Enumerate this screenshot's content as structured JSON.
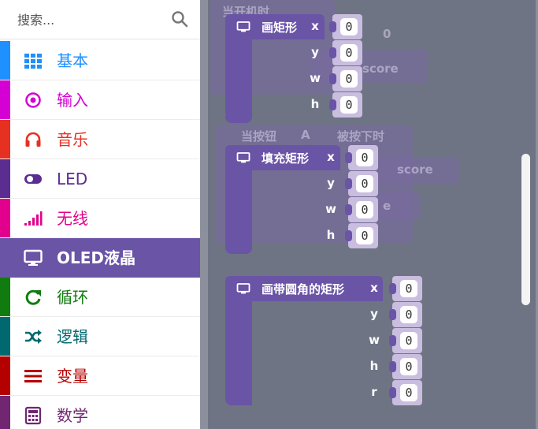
{
  "toolbox": {
    "search": {
      "placeholder": "搜索..."
    },
    "categories": [
      {
        "label": "基本",
        "icon": "grid-icon",
        "color": "#1e90ff"
      },
      {
        "label": "输入",
        "icon": "target-icon",
        "color": "#d400d4"
      },
      {
        "label": "音乐",
        "icon": "headphones-icon",
        "color": "#e63022"
      },
      {
        "label": "LED",
        "icon": "toggle-icon",
        "color": "#5c2d91"
      },
      {
        "label": "无线",
        "icon": "signal-bars-icon",
        "color": "#e3008c"
      },
      {
        "label": "OLED液晶",
        "icon": "monitor-icon",
        "color": "#6a54a6",
        "selected": true
      },
      {
        "label": "循环",
        "icon": "refresh-icon",
        "color": "#107c10"
      },
      {
        "label": "逻辑",
        "icon": "shuffle-icon",
        "color": "#006970"
      },
      {
        "label": "变量",
        "icon": "list-icon",
        "color": "#b4009e"
      },
      {
        "label": "数学",
        "icon": "calculator-icon",
        "color": "#712672"
      }
    ]
  },
  "workspace": {
    "background_text": {
      "on_start": "当开机时",
      "on_button": "当按钮",
      "button_value": "A",
      "pressed": "被按下时",
      "score": "score",
      "number_value": "0"
    },
    "blocks": [
      {
        "title": "画矩形",
        "params": [
          {
            "key": "x",
            "value": "0"
          },
          {
            "key": "y",
            "value": "0"
          },
          {
            "key": "w",
            "value": "0"
          },
          {
            "key": "h",
            "value": "0"
          }
        ]
      },
      {
        "title": "填充矩形",
        "params": [
          {
            "key": "x",
            "value": "0"
          },
          {
            "key": "y",
            "value": "0"
          },
          {
            "key": "w",
            "value": "0"
          },
          {
            "key": "h",
            "value": "0"
          }
        ]
      },
      {
        "title": "画带圆角的矩形",
        "params": [
          {
            "key": "x",
            "value": "0"
          },
          {
            "key": "y",
            "value": "0"
          },
          {
            "key": "w",
            "value": "0"
          },
          {
            "key": "h",
            "value": "0"
          },
          {
            "key": "r",
            "value": "0"
          }
        ]
      }
    ]
  }
}
